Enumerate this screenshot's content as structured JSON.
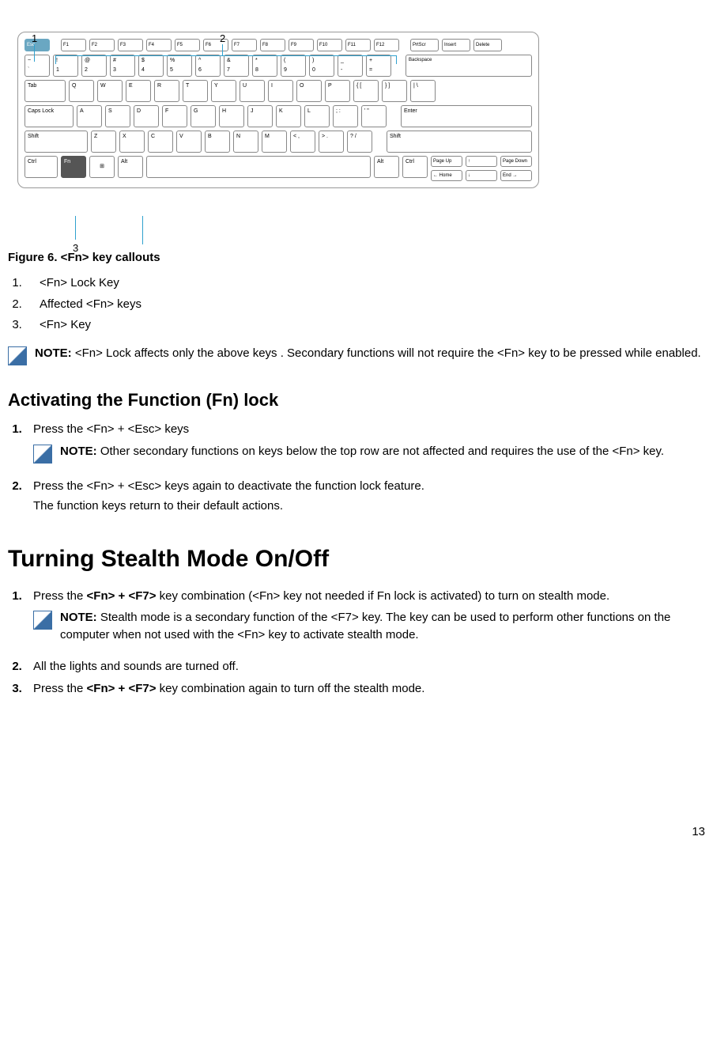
{
  "callouts": {
    "c1": "1",
    "c2": "2",
    "c3": "3"
  },
  "keyboard": {
    "fnrow": [
      "Esc",
      "F1",
      "F2",
      "F3",
      "F4",
      "F5",
      "F6",
      "F7",
      "F8",
      "F9",
      "F10",
      "F11",
      "F12",
      "PrtScr",
      "Insert",
      "Delete"
    ],
    "row1_top": [
      "~",
      "!",
      "@",
      "#",
      "$",
      "%",
      "^",
      "&",
      "*",
      "(",
      ")",
      "_",
      "+"
    ],
    "row1_bot": [
      "`",
      "1",
      "2",
      "3",
      "4",
      "5",
      "6",
      "7",
      "8",
      "9",
      "0",
      "-",
      "="
    ],
    "backspace": "Backspace",
    "tab": "Tab",
    "row2": [
      "Q",
      "W",
      "E",
      "R",
      "T",
      "Y",
      "U",
      "I",
      "O",
      "P",
      "{ [",
      "} ]",
      "| \\"
    ],
    "caps": "Caps Lock",
    "row3": [
      "A",
      "S",
      "D",
      "F",
      "G",
      "H",
      "J",
      "K",
      "L",
      "; :",
      "' \""
    ],
    "enter": "Enter",
    "lshift": "Shift",
    "row4": [
      "Z",
      "X",
      "C",
      "V",
      "B",
      "N",
      "M",
      "< ,",
      "> .",
      "? /"
    ],
    "rshift": "Shift",
    "ctrl": "Ctrl",
    "fn": "Fn",
    "win": "⊞",
    "alt": "Alt",
    "ralt": "Alt",
    "rctrl": "Ctrl",
    "nav": {
      "pgup": "Page Up",
      "up": "↑",
      "pgdn": "Page Down",
      "home": "← Home",
      "down": "↓",
      "end": "End →"
    }
  },
  "figure_caption": "Figure 6. <Fn> key callouts",
  "callout_list": [
    "<Fn> Lock Key",
    "Affected <Fn> keys",
    "<Fn> Key"
  ],
  "note1": {
    "label": "NOTE: ",
    "text": "<Fn> Lock affects only the above keys . Secondary functions will not require the <Fn> key to be pressed while enabled."
  },
  "section1_heading": "Activating the Function (Fn) lock",
  "section1_steps": {
    "s1": "Press the <Fn> + <Esc> keys",
    "s1_note_label": "NOTE: ",
    "s1_note_text": "Other secondary functions on keys below the top row are not affected and requires the use of the <Fn> key.",
    "s2": "Press the <Fn> + <Esc> keys again to deactivate the function lock feature.",
    "s2_sub": "The function keys return to their default actions."
  },
  "section2_heading": "Turning Stealth Mode On/Off",
  "section2_steps": {
    "s1_a": "Press the ",
    "s1_b": "<Fn> + <F7>",
    "s1_c": " key combination (<Fn> key not needed if Fn lock is activated) to turn on stealth mode.",
    "s1_note_label": "NOTE: ",
    "s1_note_text": "Stealth mode is a secondary function of the <F7> key. The key can be used to perform other functions on the computer when not used with the <Fn> key to activate stealth mode.",
    "s2": "All the lights and sounds are turned off.",
    "s3_a": "Press the ",
    "s3_b": "<Fn> + <F7>",
    "s3_c": " key combination again to turn off the stealth mode."
  },
  "page_number": "13"
}
